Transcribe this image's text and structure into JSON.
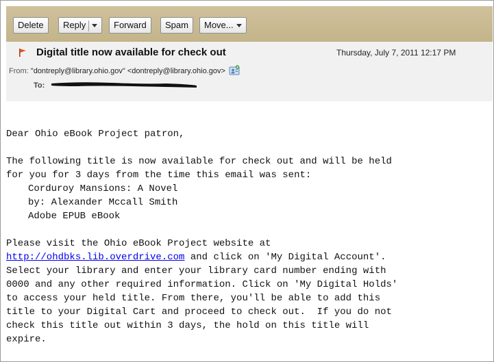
{
  "toolbar": {
    "delete_label": "Delete",
    "reply_label": "Reply",
    "forward_label": "Forward",
    "spam_label": "Spam",
    "move_label": "Move..."
  },
  "message": {
    "subject": "Digital title now available for check out",
    "date": "Thursday, July 7, 2011 12:17 PM",
    "from_label": "From:",
    "from_value": "\"dontreply@library.ohio.gov\" <dontreply@library.ohio.gov>",
    "to_label": "To:"
  },
  "body": {
    "greeting": "Dear Ohio eBook Project patron,",
    "para1_line1": "The following title is now available for check out and will be held",
    "para1_line2": "for you for 3 days from the time this email was sent:",
    "book_title": "Corduroy Mansions: A Novel",
    "book_author": "by: Alexander Mccall Smith",
    "book_format": "Adobe EPUB eBook",
    "para2_line1": "Please visit the Ohio eBook Project website at",
    "link_text": "http://ohdbks.lib.overdrive.com",
    "para2_line2_rest": " and click on 'My Digital Account'.",
    "para2_line3": "Select your library and enter your library card number ending with",
    "para2_line4": "0000 and any other required information. Click on 'My Digital Holds'",
    "para2_line5": "to access your held title. From there, you'll be able to add this",
    "para2_line6": "title to your Digital Cart and proceed to check out.  If you do not",
    "para2_line7": "check this title out within 3 days, the hold on this title will",
    "para2_line8": "expire."
  },
  "colors": {
    "toolbar_bg": "#c8b990",
    "header_bg": "#f1f1f1",
    "flag": "#e8521c",
    "link": "#0000ee"
  },
  "icons": {
    "flag": "flag-icon",
    "contact": "contact-card-icon",
    "dropdown": "chevron-down-icon"
  }
}
